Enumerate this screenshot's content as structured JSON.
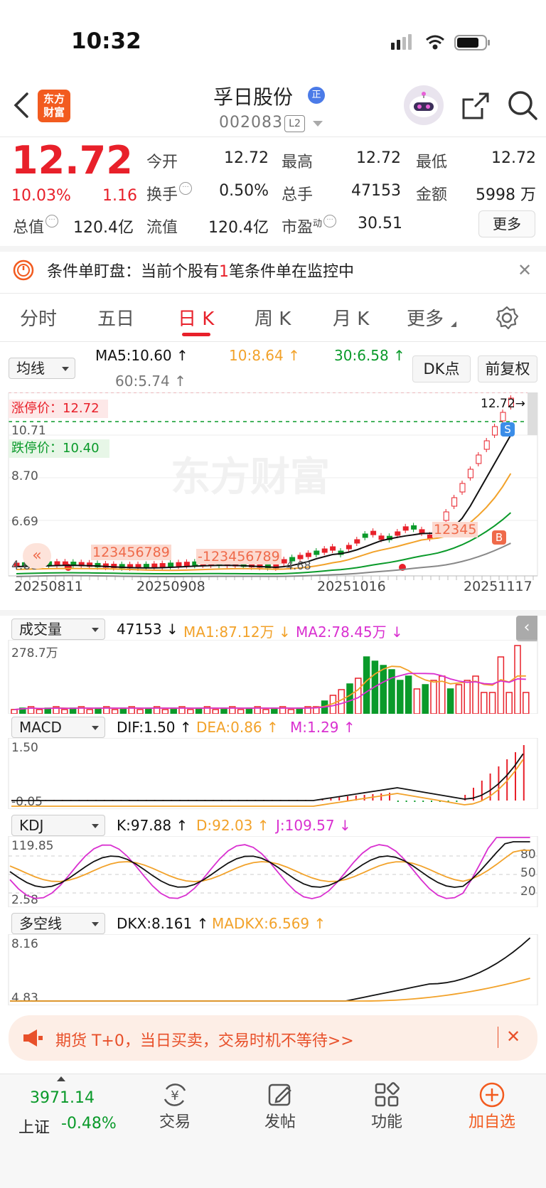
{
  "status_bar": {
    "time": "10:32"
  },
  "header": {
    "app_logo_text": [
      "东方",
      "财富"
    ],
    "stock_name": "孚日股份",
    "name_badge": "正",
    "stock_code": "002083",
    "level_badge": "L2"
  },
  "quote": {
    "price": "12.72",
    "change_pct": "10.03%",
    "change_amt": "1.16",
    "fields": {
      "open_label": "今开",
      "open_value": "12.72",
      "high_label": "最高",
      "high_value": "12.72",
      "low_label": "最低",
      "low_value": "12.72",
      "turnover_label": "换手",
      "turnover_value": "0.50%",
      "volume_label": "总手",
      "volume_value": "47153",
      "amount_label": "金额",
      "amount_value": "5998 万",
      "mktcap_label": "总值",
      "mktcap_value": "120.4亿",
      "float_label": "流值",
      "float_value": "120.4亿",
      "pe_label": "市盈",
      "pe_sup": "动",
      "pe_value": "30.51"
    },
    "more_button": "更多"
  },
  "alert": {
    "prefix": "条件单盯盘：当前个股有",
    "count": "1",
    "suffix": "笔条件单在监控中"
  },
  "tabs": [
    "分时",
    "五日",
    "日 K",
    "周 K",
    "月 K",
    "更多"
  ],
  "kline": {
    "ma_select": "均线",
    "ma5": "MA5:10.60 ↑",
    "ma10": "10:8.64 ↑",
    "ma30": "30:6.58 ↑",
    "ma60": "60:5.74 ↑",
    "dk_button": "DK点",
    "adjust_button": "前复权",
    "limit_up_label": "涨停价：12.72",
    "limit_down_label": "跌停价：10.40",
    "y_labels": [
      "12.72",
      "10.71",
      "8.70",
      "6.69",
      "4.68"
    ],
    "latest_marker": "12.72→",
    "low_marker": "4.68",
    "dates": [
      "20250811",
      "20250908",
      "20251016",
      "20251117"
    ],
    "watermark": "东方财富",
    "seq_a": "123456789",
    "seq_b": "-123456789",
    "seq_c": "12345",
    "b_marker": "B",
    "s_marker": "S",
    "chart_data": {
      "type": "line",
      "series": [
        {
          "name": "MA5",
          "last": 10.6,
          "color": "#111111"
        },
        {
          "name": "MA10",
          "last": 8.64,
          "color": "#f2a22a"
        },
        {
          "name": "MA30",
          "last": 6.58,
          "color": "#0a9a2a"
        },
        {
          "name": "MA60",
          "last": 5.74,
          "color": "#888888"
        }
      ],
      "ylim": [
        4.68,
        12.72
      ],
      "x_ticks": [
        "20250811",
        "20250908",
        "20251016",
        "20251117"
      ]
    }
  },
  "volume": {
    "select": "成交量",
    "value": "47153 ↓",
    "ma1": "MA1:87.12万 ↓",
    "ma2": "MA2:78.45万 ↓",
    "y_max": "278.7万"
  },
  "macd": {
    "select": "MACD",
    "dif": "DIF:1.50 ↑",
    "dea": "DEA:0.86 ↑",
    "m": "M:1.29 ↑",
    "y_max": "1.50",
    "y_min": "-0.05"
  },
  "kdj": {
    "select": "KDJ",
    "k": "K:97.88 ↑",
    "d": "D:92.03 ↑",
    "j": "J:109.57 ↓",
    "y_max": "119.85",
    "y_min": "2.58",
    "levels": [
      "80",
      "50",
      "20"
    ]
  },
  "dkx": {
    "select": "多空线",
    "dkx": "DKX:8.161 ↑",
    "madkx": "MADKX:6.569 ↑",
    "y_max": "8.16",
    "y_min": "4.83"
  },
  "promo": {
    "text": "期货 T+0，当日买卖，交易时机不等待>>"
  },
  "bottom_nav": {
    "index_value": "3971.14",
    "index_name": "上证",
    "index_change": "-0.48%",
    "items": [
      "交易",
      "发帖",
      "功能",
      "加自选"
    ]
  },
  "colors": {
    "up": "#e8202a",
    "down": "#0a9a2a",
    "accent": "#f25b1f"
  }
}
